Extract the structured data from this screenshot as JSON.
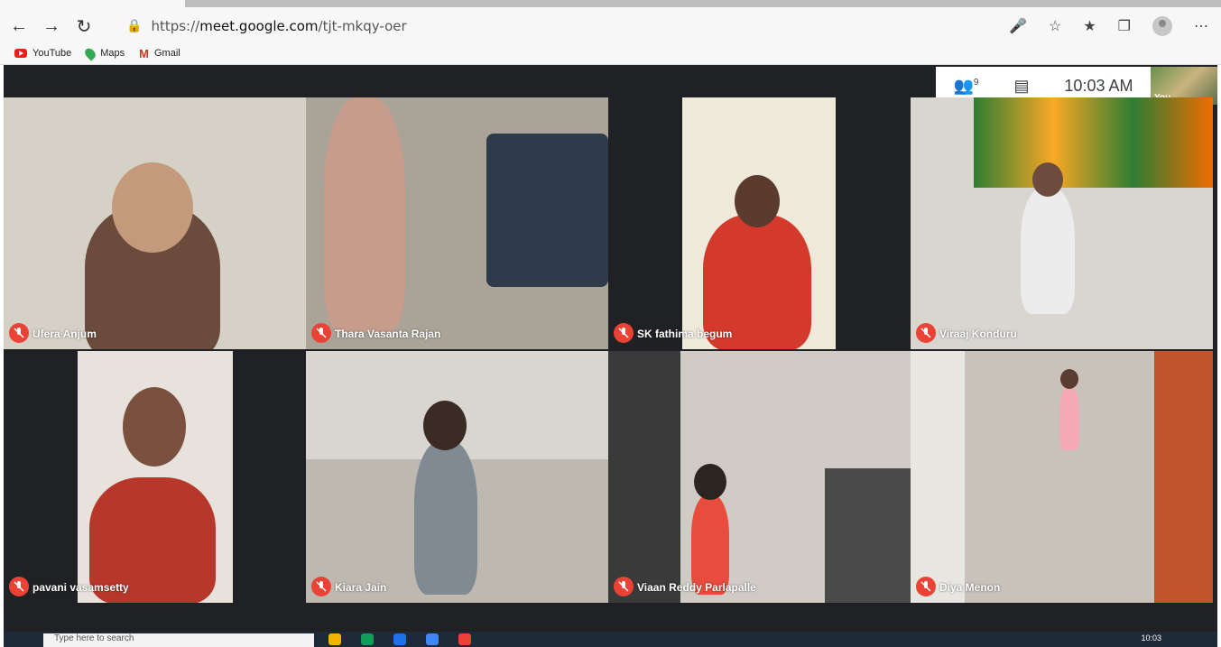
{
  "browser": {
    "url_prefix": "https://",
    "url_host": "meet.google.com",
    "url_path": "/tjt-mkqy-oer",
    "bookmarks": [
      {
        "label": "YouTube",
        "icon": "youtube-icon"
      },
      {
        "label": "Maps",
        "icon": "maps-icon"
      },
      {
        "label": "Gmail",
        "icon": "gmail-icon"
      }
    ]
  },
  "meet": {
    "participants_count": "9",
    "time": "10:03 AM",
    "self_label": "You",
    "tiles": [
      {
        "name": "Ufera Anjum",
        "bg": "#c9c2b4",
        "fg": "#3a2e27"
      },
      {
        "name": "Thara Vasanta Rajan",
        "bg": "#a6a096",
        "fg": "#c89b8a"
      },
      {
        "name": "SK fathima begum",
        "bg": "#e8e2d2",
        "fg": "#d33a2c"
      },
      {
        "name": "Viraaj Konduru",
        "bg": "#d9d6d0",
        "fg": "#f0f0f0"
      },
      {
        "name": "pavani vasamsetty",
        "bg": "#d7d2c8",
        "fg": "#c0392b"
      },
      {
        "name": "Kiara Jain",
        "bg": "#b9b5ad",
        "fg": "#7f8a93"
      },
      {
        "name": "Viaan Reddy Parlapalle",
        "bg": "#cfcbc3",
        "fg": "#e74c3c"
      },
      {
        "name": "Diya Menon",
        "bg": "#c8c2bb",
        "fg": "#f4a9b4"
      }
    ]
  },
  "taskbar": {
    "search_placeholder": "Type here to search",
    "clock": "10:03"
  },
  "colors": {
    "meet_bg": "#202124",
    "mute_red": "#ea4335"
  }
}
